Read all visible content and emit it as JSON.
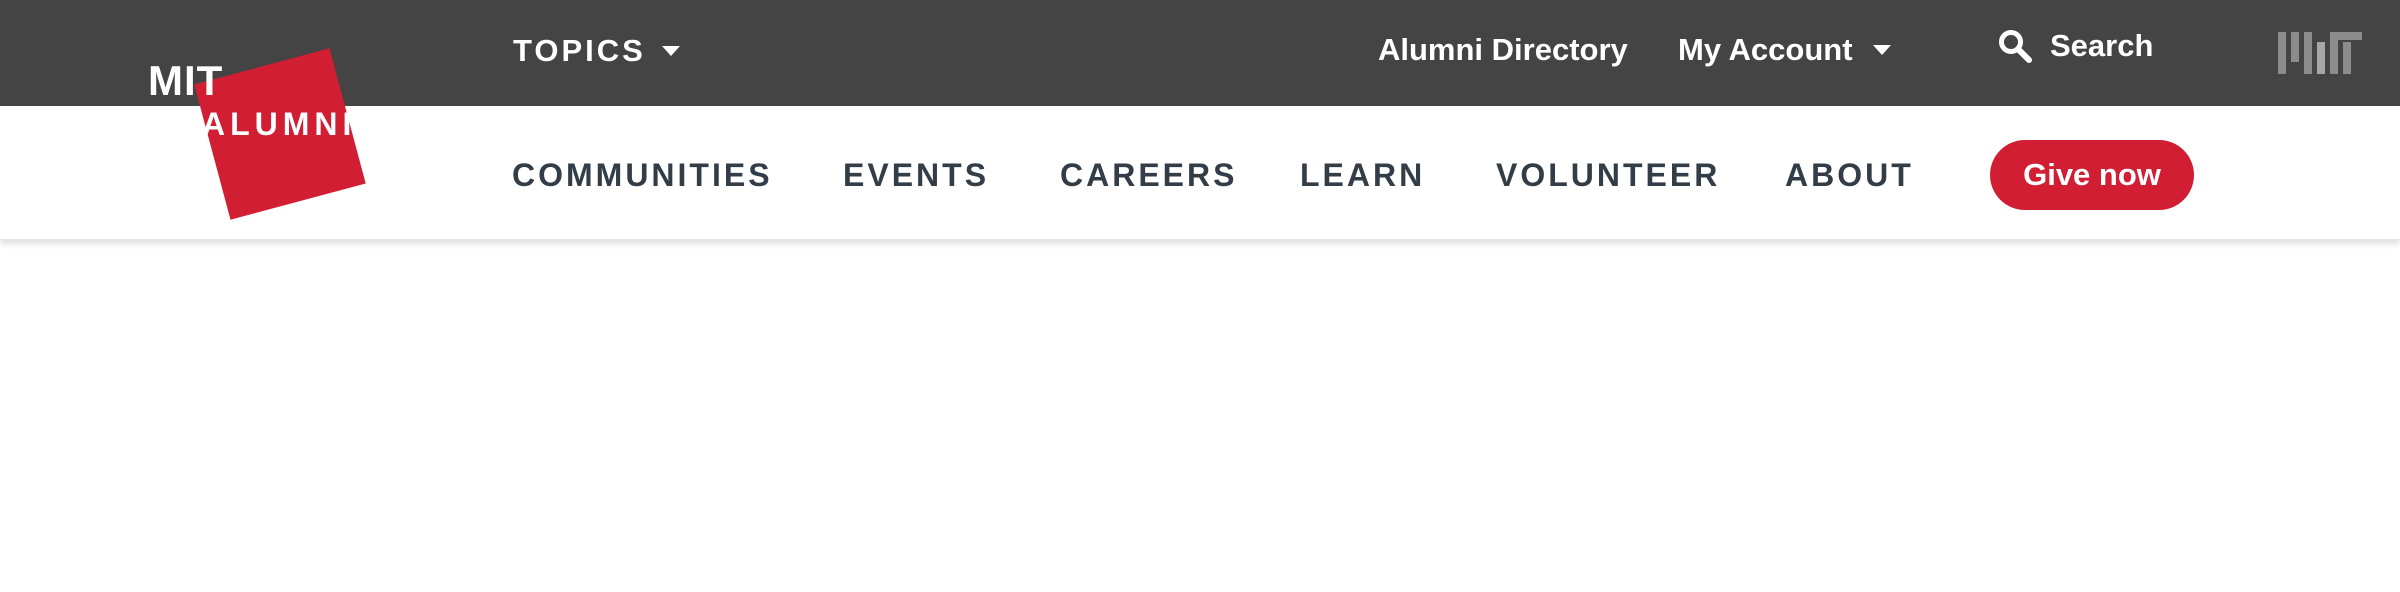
{
  "logo": {
    "line1": "MIT",
    "line2": "ALUMNI"
  },
  "topbar": {
    "topics_label": "TOPICS",
    "alumni_directory": "Alumni Directory",
    "my_account": "My Account",
    "search_label": "Search"
  },
  "mainnav": {
    "items": [
      {
        "label": "COMMUNITIES"
      },
      {
        "label": "EVENTS"
      },
      {
        "label": "CAREERS"
      },
      {
        "label": "LEARN"
      },
      {
        "label": "VOLUNTEER"
      },
      {
        "label": "ABOUT"
      }
    ],
    "give_label": "Give now"
  },
  "colors": {
    "topbar_bg": "#444444",
    "brand_red": "#d21e33",
    "nav_text": "#333d47",
    "mit_mark_gray": "#8c8c8c"
  },
  "icons": [
    "chevron-down-icon",
    "search-icon",
    "mit-logo-icon"
  ]
}
